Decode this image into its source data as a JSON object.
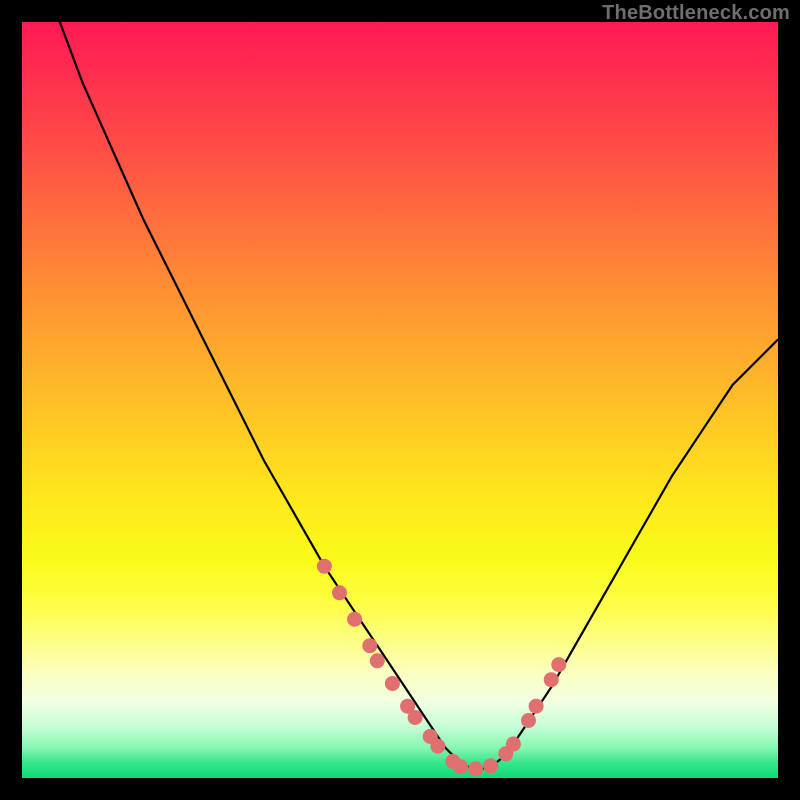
{
  "watermark": "TheBottleneck.com",
  "colors": {
    "frame": "#000000",
    "curve": "#000000",
    "marker_fill": "#e06f6f",
    "marker_stroke": "#d45a5a"
  },
  "chart_data": {
    "type": "line",
    "title": "",
    "xlabel": "",
    "ylabel": "",
    "xlim": [
      0,
      100
    ],
    "ylim": [
      0,
      100
    ],
    "grid": false,
    "legend": false,
    "note": "No axis ticks or labels are shown; x/y are normalized 0–100 percent of the plot box. y=0 at bottom, y=100 at top. Left branch descends steeply from top-left; trough near x≈57; right branch rises.",
    "series": [
      {
        "name": "bottleneck-curve",
        "x": [
          5,
          8,
          12,
          16,
          20,
          24,
          28,
          32,
          36,
          40,
          44,
          48,
          52,
          54,
          56,
          58,
          60,
          62,
          64,
          66,
          70,
          74,
          78,
          82,
          86,
          90,
          94,
          98,
          100
        ],
        "y": [
          100,
          92,
          83,
          74,
          66,
          58,
          50,
          42,
          35,
          28,
          22,
          16,
          10,
          7,
          4,
          2,
          1,
          1.5,
          3,
          6,
          12,
          19,
          26,
          33,
          40,
          46,
          52,
          56,
          58
        ]
      }
    ],
    "markers": {
      "name": "highlight-points",
      "note": "Salmon dots near the trough; y given in same normalized units.",
      "x": [
        40,
        42,
        44,
        46,
        47,
        49,
        51,
        52,
        54,
        55,
        57,
        58,
        60,
        62,
        64,
        65,
        67,
        68,
        70,
        71
      ],
      "y": [
        28,
        24.5,
        21,
        17.5,
        15.5,
        12.5,
        9.5,
        8,
        5.5,
        4.2,
        2.2,
        1.5,
        1.2,
        1.6,
        3.2,
        4.5,
        7.6,
        9.5,
        13,
        15
      ]
    }
  }
}
